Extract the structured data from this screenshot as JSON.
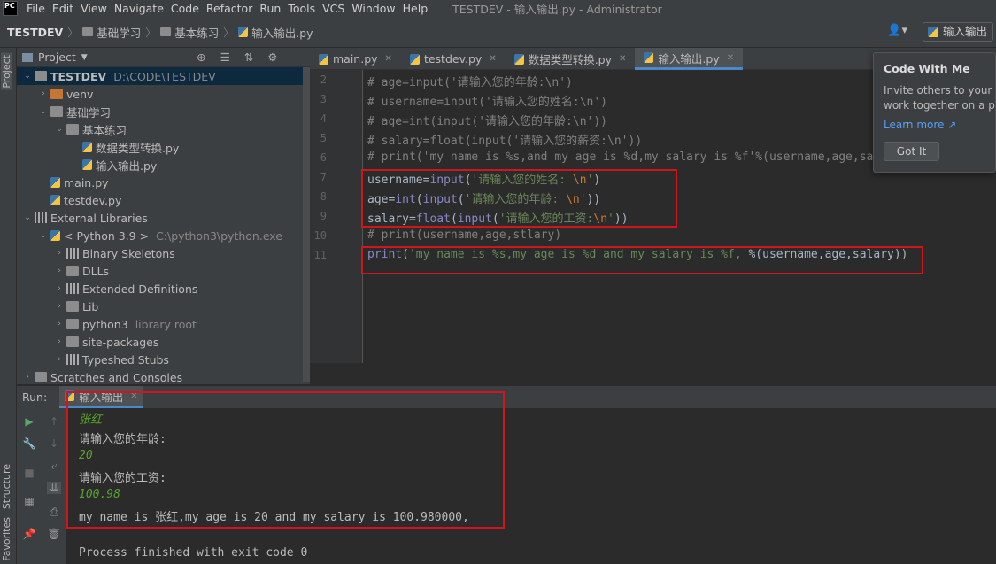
{
  "menubar": {
    "logo": "PC",
    "items": [
      "File",
      "Edit",
      "View",
      "Navigate",
      "Code",
      "Refactor",
      "Run",
      "Tools",
      "VCS",
      "Window",
      "Help"
    ],
    "window_title": "TESTDEV - 输入输出.py - Administrator"
  },
  "navbar": {
    "crumbs": [
      "TESTDEV",
      "基础学习",
      "基本练习",
      "输入输出.py"
    ],
    "run_config": "输入输出"
  },
  "sidebar": {
    "project_tab": "Project",
    "structure_tab": "Structure",
    "favorites_tab": "Favorites"
  },
  "project": {
    "header": "Project",
    "tree": [
      {
        "label": "TESTDEV",
        "extra": "D:\\CODE\\TESTDEV",
        "indent": 0,
        "arrow": "v",
        "icon": "folder"
      },
      {
        "label": "venv",
        "extra": "",
        "indent": 1,
        "arrow": ">",
        "icon": "folder-orange"
      },
      {
        "label": "基础学习",
        "extra": "",
        "indent": 1,
        "arrow": "v",
        "icon": "folder"
      },
      {
        "label": "基本练习",
        "extra": "",
        "indent": 2,
        "arrow": "v",
        "icon": "folder"
      },
      {
        "label": "数据类型转换.py",
        "extra": "",
        "indent": 3,
        "arrow": "",
        "icon": "py"
      },
      {
        "label": "输入输出.py",
        "extra": "",
        "indent": 3,
        "arrow": "",
        "icon": "py"
      },
      {
        "label": "main.py",
        "extra": "",
        "indent": 1,
        "arrow": "",
        "icon": "py"
      },
      {
        "label": "testdev.py",
        "extra": "",
        "indent": 1,
        "arrow": "",
        "icon": "py"
      },
      {
        "label": "External Libraries",
        "extra": "",
        "indent": 0,
        "arrow": "v",
        "icon": "lib"
      },
      {
        "label": "< Python 3.9 >",
        "extra": "C:\\python3\\python.exe",
        "indent": 1,
        "arrow": "v",
        "icon": "py"
      },
      {
        "label": "Binary Skeletons",
        "extra": "",
        "indent": 2,
        "arrow": ">",
        "icon": "lib"
      },
      {
        "label": "DLLs",
        "extra": "",
        "indent": 2,
        "arrow": ">",
        "icon": "folder"
      },
      {
        "label": "Extended Definitions",
        "extra": "",
        "indent": 2,
        "arrow": ">",
        "icon": "lib"
      },
      {
        "label": "Lib",
        "extra": "",
        "indent": 2,
        "arrow": ">",
        "icon": "folder"
      },
      {
        "label": "python3",
        "extra": "library root",
        "indent": 2,
        "arrow": ">",
        "icon": "folder"
      },
      {
        "label": "site-packages",
        "extra": "",
        "indent": 2,
        "arrow": ">",
        "icon": "folder"
      },
      {
        "label": "Typeshed Stubs",
        "extra": "",
        "indent": 2,
        "arrow": ">",
        "icon": "lib"
      },
      {
        "label": "Scratches and Consoles",
        "extra": "",
        "indent": 0,
        "arrow": ">",
        "icon": "folder"
      }
    ]
  },
  "editor": {
    "tabs": [
      {
        "label": "main.py",
        "active": false
      },
      {
        "label": "testdev.py",
        "active": false
      },
      {
        "label": "数据类型转换.py",
        "active": false
      },
      {
        "label": "输入输出.py",
        "active": true
      }
    ],
    "line_numbers": [
      "2",
      "3",
      "4",
      "5",
      "6",
      "7",
      "8",
      "9",
      "10",
      "11"
    ],
    "lines": [
      "# age=input('请输入您的年龄:\\n')",
      "# username=input('请输入您的姓名:\\n')",
      "# age=int(input('请输入您的年龄:\\n'))",
      "# salary=float(input('请输入您的薪资:\\n'))",
      "# print('my name is %s,and my age is %d,my salary is %f'%(username,age,salary))",
      "username=input('请输入您的姓名: \\n')",
      "age=int(input('请输入您的年龄: \\n'))",
      "salary=float(input('请输入您的工资:\\n'))",
      "# print(username,age,stlary)",
      "print('my name is %s,my age is %d and my salary is %f,'%(username,age,salary))"
    ]
  },
  "run": {
    "label": "Run:",
    "tab": "输入输出",
    "console": [
      {
        "text": "张红",
        "input": true
      },
      {
        "text": "请输入您的年龄:",
        "input": false
      },
      {
        "text": "20",
        "input": true
      },
      {
        "text": "请输入您的工资:",
        "input": false
      },
      {
        "text": "100.98",
        "input": true
      },
      {
        "text": "my name is 张红,my age is 20 and my salary is 100.980000,",
        "input": false
      },
      {
        "text": "",
        "input": false
      },
      {
        "text": "Process finished with exit code 0",
        "input": false
      }
    ]
  },
  "popup": {
    "title": "Code With Me",
    "body_1": "Invite others to your IDE to",
    "body_2": "work together on a project",
    "link": "Learn more ↗",
    "button": "Got It"
  }
}
